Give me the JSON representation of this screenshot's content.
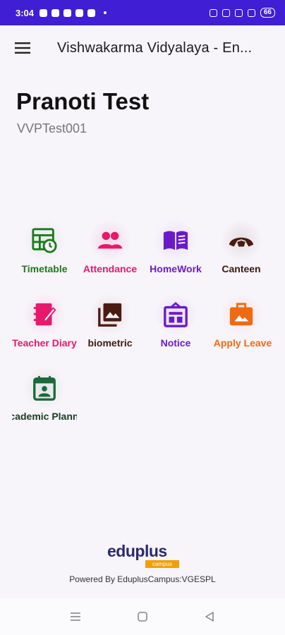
{
  "status_bar": {
    "time": "3:04",
    "battery": "66"
  },
  "app_bar": {
    "title": "Vishwakarma Vidyalaya - En..."
  },
  "user": {
    "name": "Pranoti Test",
    "id": "VVPTest001"
  },
  "tiles": [
    {
      "label": "Timetable",
      "color": "#1b7a1b",
      "icon": "timetable-icon"
    },
    {
      "label": "Attendance",
      "color": "#e8186c",
      "icon": "attendance-icon"
    },
    {
      "label": "HomeWork",
      "color": "#6a1bc8",
      "icon": "homework-book-icon"
    },
    {
      "label": "Canteen",
      "color": "#4a1b10",
      "icon": "canteen-croissant-icon"
    },
    {
      "label": "Teacher Diary",
      "color": "#e8186c",
      "icon": "teacher-diary-icon"
    },
    {
      "label": "biometric",
      "color": "#4a1b10",
      "icon": "biometric-gallery-icon"
    },
    {
      "label": "Notice",
      "color": "#6a1bc8",
      "icon": "notice-icon"
    },
    {
      "label": "Apply Leave",
      "color": "#ef6a12",
      "icon": "apply-leave-icon"
    },
    {
      "label": "Academic Planner",
      "color": "#1b6a3a",
      "icon": "academic-planner-icon"
    }
  ],
  "footer": {
    "logo_text": "eduplus",
    "logo_tag": "campus",
    "powered_by": "Powered By EduplusCampus:VGESPL"
  }
}
